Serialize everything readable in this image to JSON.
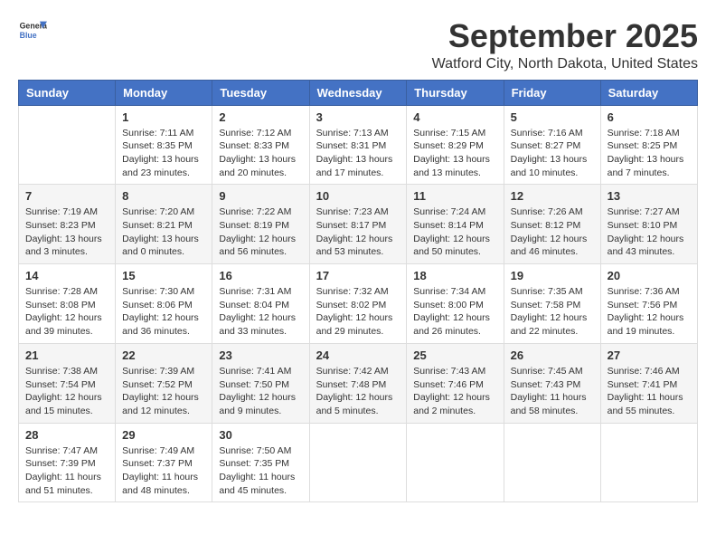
{
  "logo": {
    "line1": "General",
    "line2": "Blue"
  },
  "header": {
    "month": "September 2025",
    "location": "Watford City, North Dakota, United States"
  },
  "weekdays": [
    "Sunday",
    "Monday",
    "Tuesday",
    "Wednesday",
    "Thursday",
    "Friday",
    "Saturday"
  ],
  "weeks": [
    [
      {
        "day": "",
        "sunrise": "",
        "sunset": "",
        "daylight": ""
      },
      {
        "day": "1",
        "sunrise": "Sunrise: 7:11 AM",
        "sunset": "Sunset: 8:35 PM",
        "daylight": "Daylight: 13 hours and 23 minutes."
      },
      {
        "day": "2",
        "sunrise": "Sunrise: 7:12 AM",
        "sunset": "Sunset: 8:33 PM",
        "daylight": "Daylight: 13 hours and 20 minutes."
      },
      {
        "day": "3",
        "sunrise": "Sunrise: 7:13 AM",
        "sunset": "Sunset: 8:31 PM",
        "daylight": "Daylight: 13 hours and 17 minutes."
      },
      {
        "day": "4",
        "sunrise": "Sunrise: 7:15 AM",
        "sunset": "Sunset: 8:29 PM",
        "daylight": "Daylight: 13 hours and 13 minutes."
      },
      {
        "day": "5",
        "sunrise": "Sunrise: 7:16 AM",
        "sunset": "Sunset: 8:27 PM",
        "daylight": "Daylight: 13 hours and 10 minutes."
      },
      {
        "day": "6",
        "sunrise": "Sunrise: 7:18 AM",
        "sunset": "Sunset: 8:25 PM",
        "daylight": "Daylight: 13 hours and 7 minutes."
      }
    ],
    [
      {
        "day": "7",
        "sunrise": "Sunrise: 7:19 AM",
        "sunset": "Sunset: 8:23 PM",
        "daylight": "Daylight: 13 hours and 3 minutes."
      },
      {
        "day": "8",
        "sunrise": "Sunrise: 7:20 AM",
        "sunset": "Sunset: 8:21 PM",
        "daylight": "Daylight: 13 hours and 0 minutes."
      },
      {
        "day": "9",
        "sunrise": "Sunrise: 7:22 AM",
        "sunset": "Sunset: 8:19 PM",
        "daylight": "Daylight: 12 hours and 56 minutes."
      },
      {
        "day": "10",
        "sunrise": "Sunrise: 7:23 AM",
        "sunset": "Sunset: 8:17 PM",
        "daylight": "Daylight: 12 hours and 53 minutes."
      },
      {
        "day": "11",
        "sunrise": "Sunrise: 7:24 AM",
        "sunset": "Sunset: 8:14 PM",
        "daylight": "Daylight: 12 hours and 50 minutes."
      },
      {
        "day": "12",
        "sunrise": "Sunrise: 7:26 AM",
        "sunset": "Sunset: 8:12 PM",
        "daylight": "Daylight: 12 hours and 46 minutes."
      },
      {
        "day": "13",
        "sunrise": "Sunrise: 7:27 AM",
        "sunset": "Sunset: 8:10 PM",
        "daylight": "Daylight: 12 hours and 43 minutes."
      }
    ],
    [
      {
        "day": "14",
        "sunrise": "Sunrise: 7:28 AM",
        "sunset": "Sunset: 8:08 PM",
        "daylight": "Daylight: 12 hours and 39 minutes."
      },
      {
        "day": "15",
        "sunrise": "Sunrise: 7:30 AM",
        "sunset": "Sunset: 8:06 PM",
        "daylight": "Daylight: 12 hours and 36 minutes."
      },
      {
        "day": "16",
        "sunrise": "Sunrise: 7:31 AM",
        "sunset": "Sunset: 8:04 PM",
        "daylight": "Daylight: 12 hours and 33 minutes."
      },
      {
        "day": "17",
        "sunrise": "Sunrise: 7:32 AM",
        "sunset": "Sunset: 8:02 PM",
        "daylight": "Daylight: 12 hours and 29 minutes."
      },
      {
        "day": "18",
        "sunrise": "Sunrise: 7:34 AM",
        "sunset": "Sunset: 8:00 PM",
        "daylight": "Daylight: 12 hours and 26 minutes."
      },
      {
        "day": "19",
        "sunrise": "Sunrise: 7:35 AM",
        "sunset": "Sunset: 7:58 PM",
        "daylight": "Daylight: 12 hours and 22 minutes."
      },
      {
        "day": "20",
        "sunrise": "Sunrise: 7:36 AM",
        "sunset": "Sunset: 7:56 PM",
        "daylight": "Daylight: 12 hours and 19 minutes."
      }
    ],
    [
      {
        "day": "21",
        "sunrise": "Sunrise: 7:38 AM",
        "sunset": "Sunset: 7:54 PM",
        "daylight": "Daylight: 12 hours and 15 minutes."
      },
      {
        "day": "22",
        "sunrise": "Sunrise: 7:39 AM",
        "sunset": "Sunset: 7:52 PM",
        "daylight": "Daylight: 12 hours and 12 minutes."
      },
      {
        "day": "23",
        "sunrise": "Sunrise: 7:41 AM",
        "sunset": "Sunset: 7:50 PM",
        "daylight": "Daylight: 12 hours and 9 minutes."
      },
      {
        "day": "24",
        "sunrise": "Sunrise: 7:42 AM",
        "sunset": "Sunset: 7:48 PM",
        "daylight": "Daylight: 12 hours and 5 minutes."
      },
      {
        "day": "25",
        "sunrise": "Sunrise: 7:43 AM",
        "sunset": "Sunset: 7:46 PM",
        "daylight": "Daylight: 12 hours and 2 minutes."
      },
      {
        "day": "26",
        "sunrise": "Sunrise: 7:45 AM",
        "sunset": "Sunset: 7:43 PM",
        "daylight": "Daylight: 11 hours and 58 minutes."
      },
      {
        "day": "27",
        "sunrise": "Sunrise: 7:46 AM",
        "sunset": "Sunset: 7:41 PM",
        "daylight": "Daylight: 11 hours and 55 minutes."
      }
    ],
    [
      {
        "day": "28",
        "sunrise": "Sunrise: 7:47 AM",
        "sunset": "Sunset: 7:39 PM",
        "daylight": "Daylight: 11 hours and 51 minutes."
      },
      {
        "day": "29",
        "sunrise": "Sunrise: 7:49 AM",
        "sunset": "Sunset: 7:37 PM",
        "daylight": "Daylight: 11 hours and 48 minutes."
      },
      {
        "day": "30",
        "sunrise": "Sunrise: 7:50 AM",
        "sunset": "Sunset: 7:35 PM",
        "daylight": "Daylight: 11 hours and 45 minutes."
      },
      {
        "day": "",
        "sunrise": "",
        "sunset": "",
        "daylight": ""
      },
      {
        "day": "",
        "sunrise": "",
        "sunset": "",
        "daylight": ""
      },
      {
        "day": "",
        "sunrise": "",
        "sunset": "",
        "daylight": ""
      },
      {
        "day": "",
        "sunrise": "",
        "sunset": "",
        "daylight": ""
      }
    ]
  ]
}
